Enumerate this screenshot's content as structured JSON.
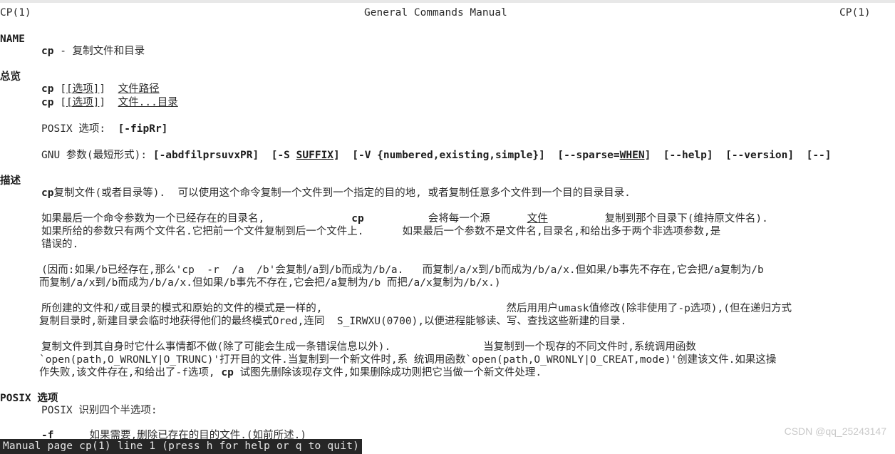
{
  "window": {
    "kind": "terminal-man-page",
    "background": "#ffffff",
    "foreground": "#2b2b2b",
    "statusbar_background": "#262626",
    "statusbar_foreground": "#e6e6e6"
  },
  "header": {
    "left": "CP(1)",
    "center": "General Commands Manual",
    "right": "CP(1)"
  },
  "sections": {
    "name": {
      "heading": "NAME",
      "body": "cp - 复制文件和目录",
      "cmd": "cp",
      "dash": " - ",
      "desc": "复制文件和目录"
    },
    "synopsis": {
      "heading": "总览",
      "line1": {
        "cmd": "cp",
        "opt": "[选项]",
        "args": "文件路径"
      },
      "line2": {
        "cmd": "cp",
        "opt": "[选项]",
        "args": "文件...目录"
      },
      "posix_label": "POSIX 选项:  ",
      "posix_value": "[-fipRr]",
      "gnu_label": "GNU 参数(最短形式): ",
      "gnu_tokens": [
        "[-abdfilprsuvxPR]",
        "[-S SUFFIX]",
        "[-V {numbered,existing,simple}]",
        "[--sparse=WHEN]",
        "[--help]",
        "[--version]",
        "[--]"
      ],
      "gnu_underlined": [
        "SUFFIX",
        "WHEN"
      ]
    },
    "description": {
      "heading": "描述",
      "p1_cmd": "cp",
      "p1": "复制文件(或者目录等).  可以使用这个命令复制一个文件到一个指定的目的地, 或者复制任意多个文件到一个目的目录目录.",
      "p2_a": "如果最后一个命令参数为一个已经存在的目录名,",
      "p2_cmd": "cp",
      "p2_b": "会将每一个源",
      "p2_u": "文件",
      "p2_c": "复制到那个目录下(维持原文件名).",
      "p2_d": "如果所给的参数只有两个文件名.它把前一个文件复制到后一个文件上.",
      "p2_e": "如果最后一个参数不是文件名,目录名,和给出多于两个非选项参数,是",
      "p2_f": "错误的.",
      "p3_l1": "(因而:如果/b已经存在,那么'cp  -r  /a  /b'会复制/a到/b而成为/b/a.   而复制/a/x到/b而成为/b/a/x.但如果/b事先不存在,它会把/a复制为/b",
      "p3_l2": "而复制/a/x到/b而成为/b/a/x.但如果/b事先不存在,它会把/a复制为/b 而把/a/x复制为/b/x.)",
      "p4_l1a": "所创建的文件和/或目录的模式和原始的文件的模式是一样的,",
      "p4_l1b": "然后用用户umask值修改(除非使用了-p选项),(但在递归方式",
      "p4_l2": "复制目录时,新建目录会临时地获得他们的最终模式Ored,连同  S_IRWXU(0700),以便进程能够读、写、查找这些新建的目录.",
      "p5_l1a": "复制文件到其自身时它什么事情都不做(除了可能会生成一条错误信息以外).",
      "p5_l1b": "当复制到一个现存的不同文件时,系统调用函数",
      "p5_l2": "`open(path,O_WRONLY|O_TRUNC)'打开目的文件.当复制到一个新文件时,系 统调用函数`open(path,O_WRONLY|O_CREAT,mode)'创建该文件.如果这操",
      "p5_l3a": "作失败,该文件存在,和给出了-f选项, ",
      "p5_l3_cmd": "cp",
      "p5_l3b": " 试图先删除该现存文件,如果删除成功则把它当做一个新文件处理."
    },
    "posix_options": {
      "heading": "POSIX 选项",
      "intro": "POSIX 识别四个半选项:",
      "items": [
        {
          "flag": "-f",
          "text": "如果需要,删除已存在的目的文件.(如前所述.)"
        }
      ]
    }
  },
  "statusbar": {
    "text": "Manual page cp(1) line 1 (press h for help or q to quit)"
  },
  "watermark": {
    "text": "CSDN @qq_25243147"
  }
}
